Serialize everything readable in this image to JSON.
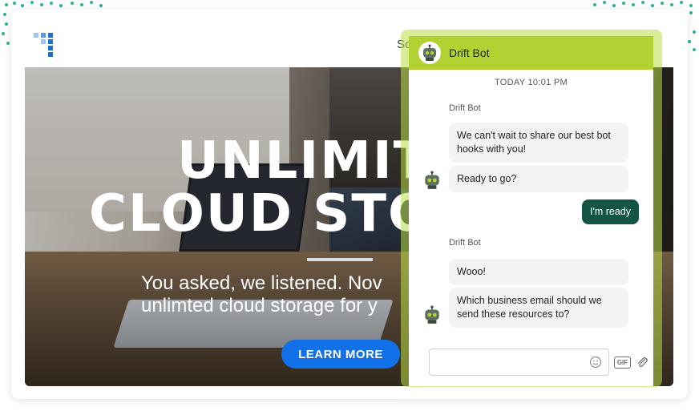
{
  "site": {
    "nav_partial": "So"
  },
  "hero": {
    "title_line1": "UNLIMIT",
    "title_line2": "CLOUD STO",
    "subtitle_line1": "You asked, we listened. Nov",
    "subtitle_line2": "unlimted cloud storage for y",
    "cta_label": "LEARN MORE"
  },
  "chat": {
    "bot_name": "Drift Bot",
    "timestamp": "TODAY 10:01 PM",
    "messages": [
      {
        "sender": "Drift Bot",
        "text": "We can't wait to share our best bot hooks with you!"
      },
      {
        "text": "Ready to go?"
      },
      {
        "from_user": true,
        "text": "I'm ready"
      },
      {
        "sender": "Drift Bot",
        "text": "Wooo!"
      },
      {
        "text": "Which business email should we send these resources to?"
      }
    ],
    "input_value": "",
    "gif_label": "GIF"
  },
  "colors": {
    "chat_header": "#b2d234",
    "user_bubble": "#145445",
    "cta": "#1271e8"
  }
}
